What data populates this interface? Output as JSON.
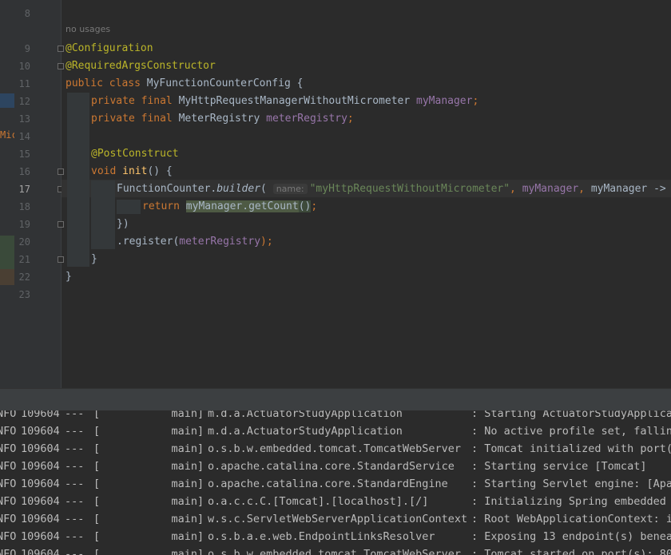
{
  "editor": {
    "line_numbers": [
      "8",
      "9",
      "10",
      "11",
      "12",
      "13",
      "14",
      "15",
      "16",
      "17",
      "18",
      "19",
      "20",
      "21",
      "22",
      "23"
    ],
    "current_line": "17",
    "usages_hint": "no usages",
    "left_strip_text": "Mic",
    "code": {
      "l9": "@Configuration",
      "l10": "@RequiredArgsConstructor",
      "l11_public": "public",
      "l11_class": "class",
      "l11_name": "MyFunctionCounterConfig",
      "l11_brace": "{",
      "l12_private": "private",
      "l12_final": "final",
      "l12_type": "MyHttpRequestManagerWithoutMicrometer",
      "l12_field": "myManager",
      "l12_semi": ";",
      "l13_private": "private",
      "l13_final": "final",
      "l13_type": "MeterRegistry",
      "l13_field": "meterRegistry",
      "l13_semi": ";",
      "l15": "@PostConstruct",
      "l16_void": "void",
      "l16_name": "init",
      "l16_rest": "() {",
      "l17_class": "FunctionCounter",
      "l17_dot": ".",
      "l17_method": "builder",
      "l17_paren": "(",
      "l17_hint": "name:",
      "l17_string": "\"myHttpRequestWithoutMicrometer\"",
      "l17_comma1": ",",
      "l17_arg2": "myManager",
      "l17_comma2": ",",
      "l17_arg3": "myManager",
      "l17_arrow": "->",
      "l18_return": "return",
      "l18_expr": "myManager.getCount",
      "l18_paren": "()",
      "l18_semi": ";",
      "l19": "})",
      "l20_method": ".register(",
      "l20_arg": "meterRegistry",
      "l20_end": ");",
      "l21": "}",
      "l22": "}"
    }
  },
  "console": {
    "lines": [
      {
        "level": "NFO",
        "pid": "109604",
        "sep": "---",
        "thread": "[           main]",
        "logger": "m.d.a.ActuatorStudyApplication",
        "message": ": Starting ActuatorStudyApplicat"
      },
      {
        "level": "NFO",
        "pid": "109604",
        "sep": "---",
        "thread": "[           main]",
        "logger": "m.d.a.ActuatorStudyApplication",
        "message": ": No active profile set, fallin"
      },
      {
        "level": "NFO",
        "pid": "109604",
        "sep": "---",
        "thread": "[           main]",
        "logger": "o.s.b.w.embedded.tomcat.TomcatWebServer",
        "message": ": Tomcat initialized with port(s"
      },
      {
        "level": "NFO",
        "pid": "109604",
        "sep": "---",
        "thread": "[           main]",
        "logger": "o.apache.catalina.core.StandardService",
        "message": ": Starting service [Tomcat]"
      },
      {
        "level": "NFO",
        "pid": "109604",
        "sep": "---",
        "thread": "[           main]",
        "logger": "o.apache.catalina.core.StandardEngine",
        "message": ": Starting Servlet engine: [Apac"
      },
      {
        "level": "NFO",
        "pid": "109604",
        "sep": "---",
        "thread": "[           main]",
        "logger": "o.a.c.c.C.[Tomcat].[localhost].[/]",
        "message": ": Initializing Spring embedded W"
      },
      {
        "level": "NFO",
        "pid": "109604",
        "sep": "---",
        "thread": "[           main]",
        "logger": "w.s.c.ServletWebServerApplicationContext",
        "message": ": Root WebApplicationContext: in"
      },
      {
        "level": "NFO",
        "pid": "109604",
        "sep": "---",
        "thread": "[           main]",
        "logger": "o.s.b.a.e.web.EndpointLinksResolver",
        "message": ": Exposing 13 endpoint(s) beneat"
      },
      {
        "level": "NFO",
        "pid": "109604",
        "sep": "---",
        "thread": "[           main]",
        "logger": "o.s.b.w.embedded.tomcat.TomcatWebServer",
        "message": ": Tomcat started on port(s): 80"
      }
    ]
  },
  "colors": {
    "background": "#2b2b2b",
    "keyword": "#cc7832",
    "annotation": "#bbb529",
    "field": "#9876aa",
    "string": "#6a8759",
    "method": "#ffc66d"
  }
}
